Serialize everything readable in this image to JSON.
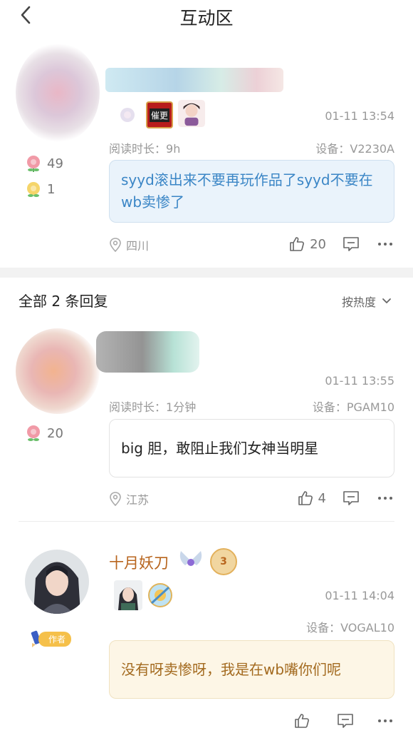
{
  "header": {
    "title": "互动区"
  },
  "main_comment": {
    "time": "01-11 13:54",
    "read_label": "阅读时长：",
    "read_value": "9h",
    "device_label": "设备：",
    "device_value": "V2230A",
    "flowers": "49",
    "flowers2": "1",
    "badge_text": "催更",
    "text": "syyd滚出来不要再玩作品了syyd不要在wb卖惨了",
    "location": "四川",
    "likes": "20"
  },
  "replies_header": {
    "all_label": "全部 2 条回复",
    "sort_label": "按热度"
  },
  "replies": [
    {
      "time": "01-11 13:55",
      "read_label": "阅读时长：",
      "read_value": "1分钟",
      "device_label": "设备：",
      "device_value": "PGAM10",
      "flowers": "20",
      "text": "big 胆，敢阻止我们女神当明星",
      "location": "江苏",
      "likes": "4"
    },
    {
      "name": "十月妖刀",
      "level": "3",
      "author_tag": "作者",
      "time": "01-11 14:04",
      "device_label": "设备：",
      "device_value": "VOGAL10",
      "text": "没有呀卖惨呀，我是在wb嘴你们呢"
    }
  ],
  "colors": {
    "accent_blue": "#3b86c6",
    "author_brown": "#b8651e",
    "reply_brown": "#a36a1f"
  }
}
